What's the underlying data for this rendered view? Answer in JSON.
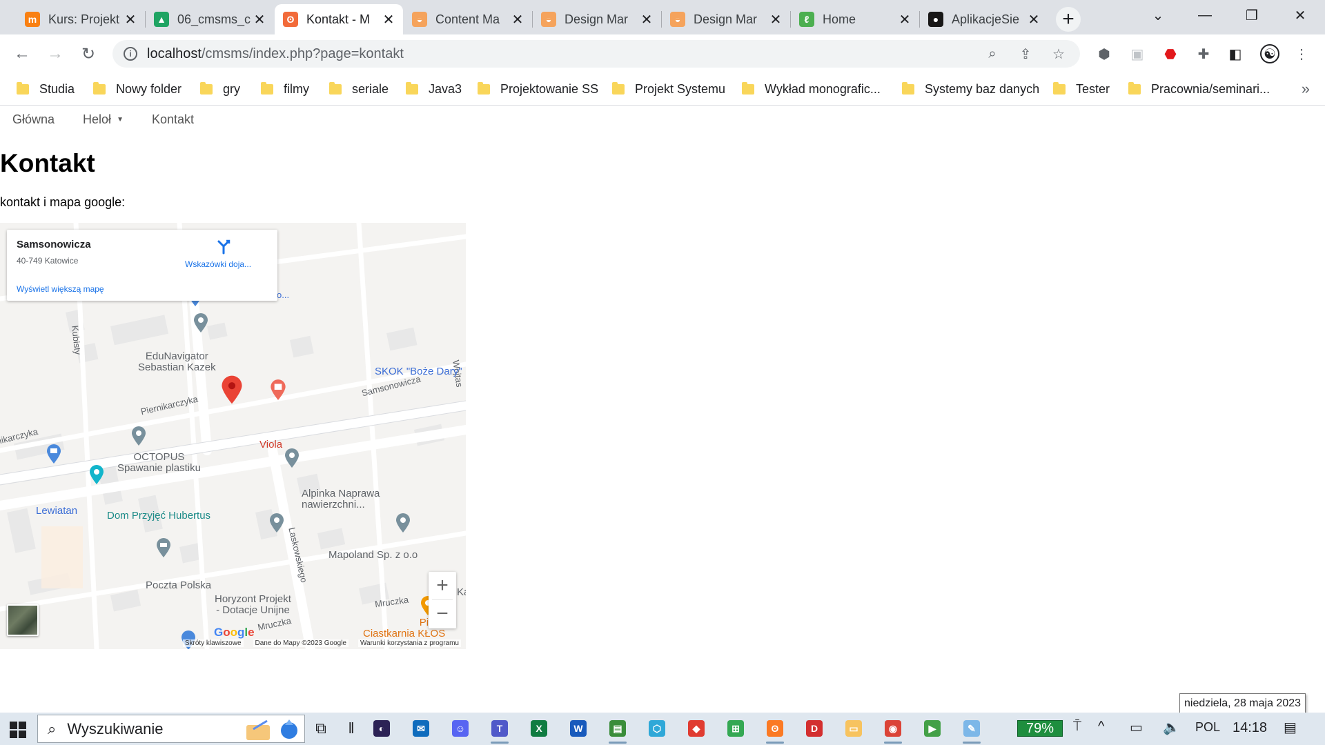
{
  "browser": {
    "tabs": [
      {
        "title": "Kurs: Projekt",
        "icon": "moodle-icon",
        "color": "#f98012",
        "glyph": "m"
      },
      {
        "title": "06_cmsms_c",
        "icon": "google-drive-icon",
        "color": "#1fa463",
        "glyph": "▲"
      },
      {
        "title": "Kontakt - M",
        "icon": "cmsms-icon",
        "color": "#f26b3a",
        "glyph": "ʘ"
      },
      {
        "title": "Content Ma",
        "icon": "cmsms-admin-icon",
        "color": "#f5a35c",
        "glyph": "◒"
      },
      {
        "title": "Design Mar",
        "icon": "cmsms-admin-icon",
        "color": "#f5a35c",
        "glyph": "◒"
      },
      {
        "title": "Design Mar",
        "icon": "cmsms-admin-icon",
        "color": "#f5a35c",
        "glyph": "◒"
      },
      {
        "title": "Home",
        "icon": "leaf-icon",
        "color": "#4caf50",
        "glyph": "ℓ"
      },
      {
        "title": "AplikacjeSie",
        "icon": "github-icon",
        "color": "#181717",
        "glyph": "●"
      }
    ],
    "active_tab": 2,
    "url_host": "localhost",
    "url_path": "/cmsms/index.php?page=kontakt",
    "bookmarks": [
      "Studia",
      "Nowy folder",
      "gry",
      "filmy",
      "seriale",
      "Java3",
      "Projektowanie SS",
      "Projekt Systemu",
      "Wykład monografic...",
      "Systemy baz danych",
      "Tester",
      "Pracownia/seminari..."
    ],
    "more_bookmarks": "»"
  },
  "page": {
    "nav": [
      "Główna",
      "Heloł",
      "Kontakt"
    ],
    "title": "Kontakt",
    "text": "kontakt i mapa google:"
  },
  "map": {
    "place_name": "Samsonowicza",
    "place_address": "40-749 Katowice",
    "directions_label": "Wskazówki doja...",
    "larger_map_label": "Wyświetl większą mapę",
    "partial_label": "o...",
    "roads": [
      "Kubisty",
      "Piernikarczyka",
      "nikarczyka",
      "Samsonowicza",
      "Wojtas",
      "Laskowskiego",
      "Mruczka",
      "Mruczka"
    ],
    "pois": [
      {
        "name": "EduNavigator\nSebastian Kazek",
        "color": "gray"
      },
      {
        "name": "SKOK \"Boże Dary\"",
        "color": "blue"
      },
      {
        "name": "Viola",
        "color": "red"
      },
      {
        "name": "OCTOPUS\nSpawanie plastiku",
        "color": "gray"
      },
      {
        "name": "Lewiatan",
        "color": "blue"
      },
      {
        "name": "Dom Przyjęć Hubertus",
        "color": "teal"
      },
      {
        "name": "Alpinka Naprawa\nnawierzchni...",
        "color": "gray"
      },
      {
        "name": "Mapoland Sp. z o.o",
        "color": "gray"
      },
      {
        "name": "Poczta Polska",
        "color": "gray"
      },
      {
        "name": "Horyzont Projekt\n- Dotacje Unijne",
        "color": "gray"
      },
      {
        "name": "Pieka\nCiastkarnia KŁOS",
        "color": "orange"
      },
      {
        "name": "Ka",
        "color": "gray"
      }
    ],
    "zoom_in": "+",
    "zoom_out": "−",
    "google_logo": "Google",
    "attribution": [
      "Skróty klawiszowe",
      "Dane do Mapy ©2023 Google",
      "Warunki korzystania z programu"
    ]
  },
  "taskbar": {
    "search_placeholder": "Wyszukiwanie",
    "battery": "79%",
    "language": "POL",
    "time": "14:18",
    "date_tooltip": "niedziela, 28 maja 2023"
  }
}
